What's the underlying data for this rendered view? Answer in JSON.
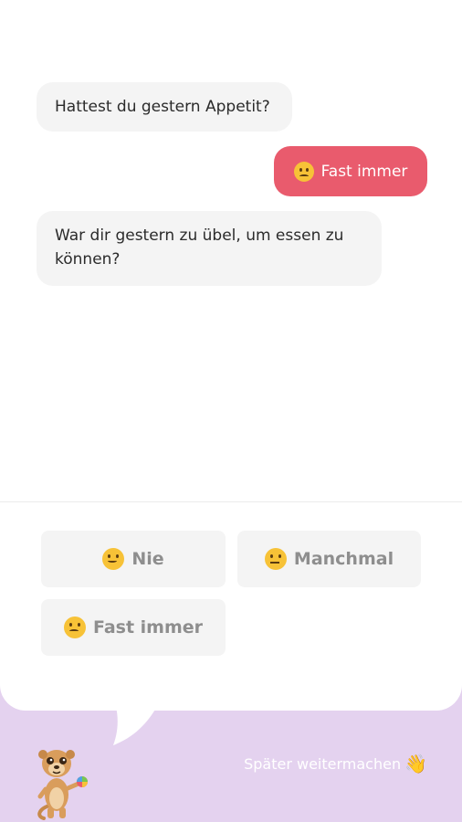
{
  "conversation": {
    "bot_question_1": "Hattest du gestern Appetit?",
    "user_answer_1": "Fast immer",
    "bot_question_2": "War dir gestern zu übel, um essen zu können?"
  },
  "options": [
    {
      "label": "Nie",
      "icon": "slightly-smiling-face-icon"
    },
    {
      "label": "Manchmal",
      "icon": "neutral-face-icon"
    },
    {
      "label": "Fast immer",
      "icon": "slightly-frowning-face-icon"
    }
  ],
  "footer": {
    "later_label": "Später weitermachen",
    "later_icon": "waving-hand-icon",
    "mascot": "meerkat-mascot"
  },
  "colors": {
    "user_bubble": "#e95b6d",
    "bot_bubble": "#f4f4f4",
    "footer_bg": "#e4d2ef",
    "emoji": "#f7c237"
  }
}
